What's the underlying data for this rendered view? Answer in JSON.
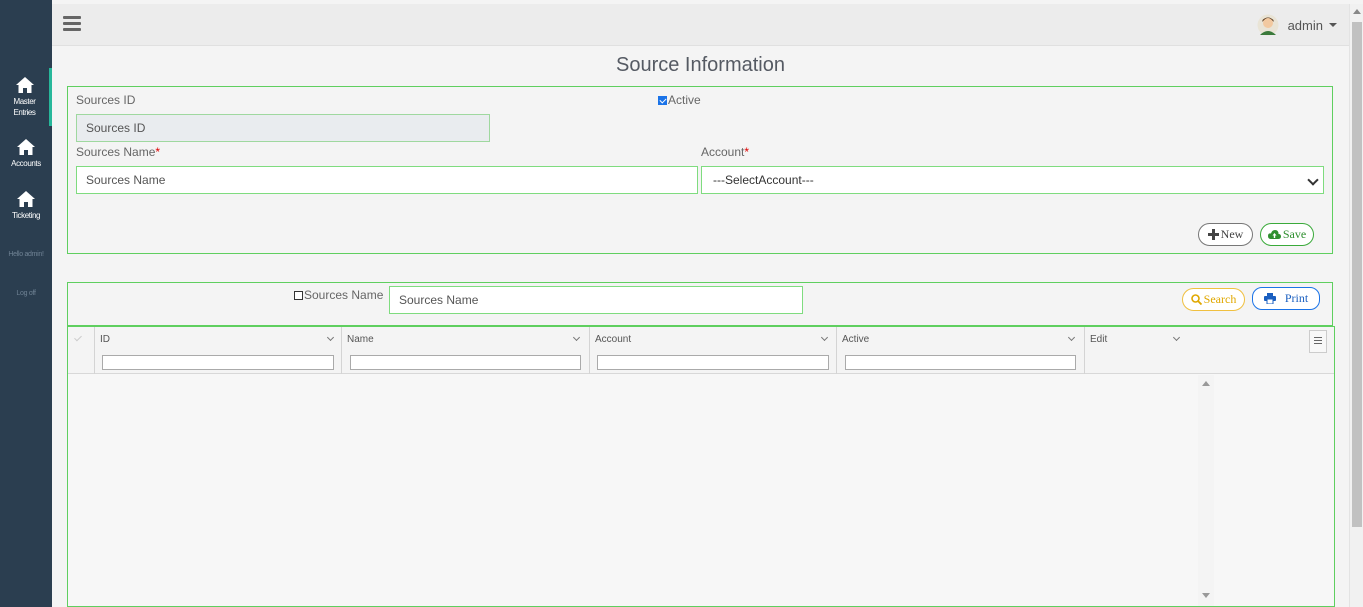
{
  "sidebar": {
    "items": [
      {
        "label_line1": "Master",
        "label_line2": "Entries",
        "icon": "home-icon"
      },
      {
        "label_line1": "Accounts",
        "label_line2": "",
        "icon": "home-icon"
      },
      {
        "label_line1": "Ticketing",
        "label_line2": "",
        "icon": "home-icon"
      }
    ],
    "greeting": "Hello admin!",
    "logout": "Log off"
  },
  "header": {
    "user_name": "admin",
    "menu_icon": "hamburger-icon",
    "avatar_icon": "user-avatar-icon"
  },
  "page": {
    "title": "Source Information"
  },
  "form": {
    "sources_id_label": "Sources ID",
    "sources_id_placeholder": "Sources ID",
    "active_label": "Active",
    "active_checked": true,
    "sources_name_label": "Sources Name",
    "sources_name_placeholder": "Sources Name",
    "required_mark": "*",
    "account_label": "Account",
    "account_selected": "---SelectAccount---",
    "new_label": "New",
    "save_label": "Save"
  },
  "search": {
    "checkbox_label": "Sources Name",
    "checkbox_checked": false,
    "input_placeholder": "Sources Name",
    "search_label": "Search",
    "print_label": "Print"
  },
  "grid": {
    "columns": [
      "ID",
      "Name",
      "Account",
      "Active",
      "Edit"
    ],
    "rows": []
  },
  "colors": {
    "sidebar_bg": "#2b3e50",
    "accent_green": "#5fcf5f",
    "active_teal": "#27b79a",
    "search_yellow": "#f0c040",
    "print_blue": "#1a73e8"
  }
}
